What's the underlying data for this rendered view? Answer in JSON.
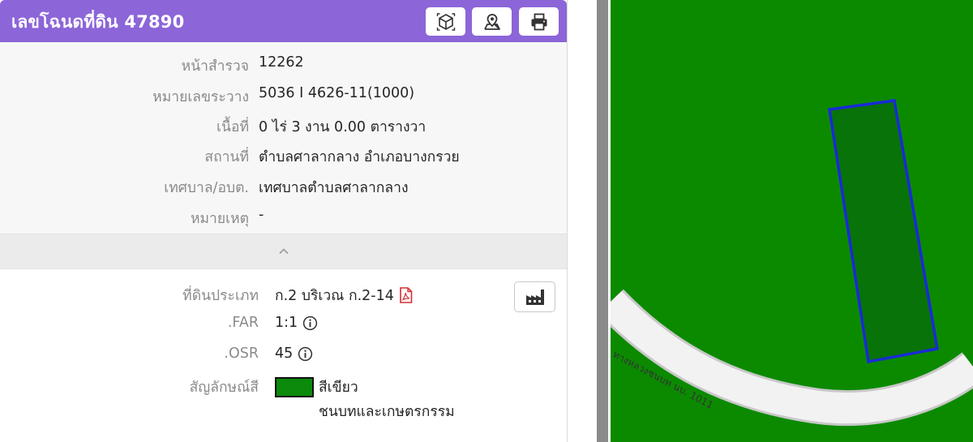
{
  "header": {
    "title": "เลขโฉนดที่ดิน 47890",
    "buttons": [
      {
        "name": "3d-view",
        "icon": "cube-icon"
      },
      {
        "name": "map-pin",
        "icon": "map-marker-icon"
      },
      {
        "name": "print",
        "icon": "printer-icon"
      }
    ]
  },
  "summary": {
    "survey_page_label": "หน้าสำรวจ",
    "survey_page_value": "12262",
    "sheet_label": "หมายเลขระวาง",
    "sheet_value": "5036 I 4626-11(1000)",
    "area_label": "เนื้อที่",
    "area_value": "0 ไร่ 3 งาน 0.00 ตารางวา",
    "location_label": "สถานที่",
    "location_value": "ตำบลศาลากลาง อำเภอบางกรวย",
    "municipality_label": "เทศบาล/อบต.",
    "municipality_value": "เทศบาลตำบลศาลากลาง",
    "note_label": "หมายเหตุ",
    "note_value": "-"
  },
  "zoning": {
    "land_type_label": "ที่ดินประเภท",
    "land_type_value": "ก.2 บริเวณ ก.2-14",
    "far_label": ".FAR",
    "far_value": "1:1",
    "osr_label": ".OSR",
    "osr_value": "45",
    "color_label": "สัญลักษณ์สี",
    "color_value": "สีเขียว",
    "color_desc": "ชนบทและเกษตรกรรม",
    "color_hex": "#0b8a0b"
  },
  "map": {
    "road_label": "ทางหลวงชนบท นบ. 1011",
    "background_color": "#0b8a00",
    "parcel_fill": "#087308",
    "parcel_stroke": "#1a2ad6"
  },
  "colors": {
    "header": "#8c65d8",
    "pdf_icon": "#d32f2f"
  }
}
